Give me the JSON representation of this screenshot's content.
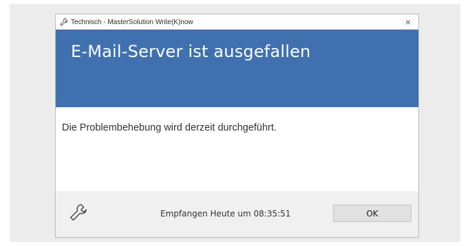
{
  "window": {
    "title": "Technisch - MasterSolution Write(K)now",
    "close_glyph": "×",
    "title_icon": "wrench-icon"
  },
  "banner": {
    "title": "E-Mail-Server ist ausgefallen",
    "color": "#3f71b0"
  },
  "message": {
    "text": "Die Problembehebung wird derzeit durchgeführt."
  },
  "footer": {
    "icon": "wrench-icon",
    "received": "Empfangen Heute um 08:35:51",
    "ok_label": "OK"
  }
}
